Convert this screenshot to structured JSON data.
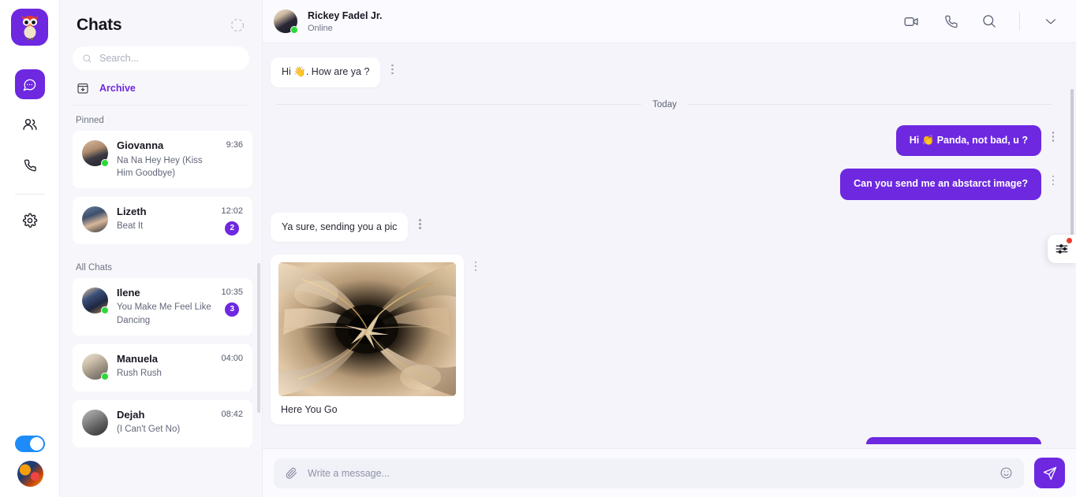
{
  "brand": {
    "accent": "#6d28e0",
    "logo_name": "owl-mascot-logo",
    "online_color": "#2fd73b"
  },
  "rail": {
    "items": [
      {
        "name": "chats",
        "icon": "chat-bubble-icon",
        "active": true
      },
      {
        "name": "contacts",
        "icon": "people-icon",
        "active": false
      },
      {
        "name": "calls",
        "icon": "phone-icon",
        "active": false
      },
      {
        "name": "settings",
        "icon": "gear-icon",
        "active": false
      }
    ],
    "theme_toggle": {
      "icon": "theme-toggle",
      "state": "on"
    },
    "avatar": "user-avatar"
  },
  "sidebar": {
    "title": "Chats",
    "refresh_icon": "refresh-dashed-icon",
    "search": {
      "value": "",
      "placeholder": "Search...",
      "icon": "search-icon"
    },
    "archive": {
      "label": "Archive",
      "icon": "archive-download-icon"
    },
    "groups": [
      {
        "title": "Pinned",
        "chats": [
          {
            "name": "Giovanna",
            "message": "Na Na Hey Hey (Kiss Him Goodbye)",
            "time": "9:36",
            "badge": "",
            "online": true,
            "avatar": "av-giovanna"
          },
          {
            "name": "Lizeth",
            "message": "Beat It",
            "time": "12:02",
            "badge": "2",
            "online": false,
            "avatar": "av-lizeth"
          }
        ]
      },
      {
        "title": "All Chats",
        "chats": [
          {
            "name": "Ilene",
            "message": "You Make Me Feel Like Dancing",
            "time": "10:35",
            "badge": "3",
            "online": true,
            "avatar": "av-ilene"
          },
          {
            "name": "Manuela",
            "message": "Rush Rush",
            "time": "04:00",
            "badge": "",
            "online": true,
            "avatar": "av-manuela"
          },
          {
            "name": "Dejah",
            "message": "(I Can't Get No)",
            "time": "08:42",
            "badge": "",
            "online": false,
            "avatar": "av-dejah"
          }
        ]
      }
    ]
  },
  "conversation": {
    "contact": {
      "name": "Rickey Fadel Jr.",
      "status": "Online",
      "avatar": "av-rickey",
      "online": true
    },
    "header_actions": [
      {
        "name": "video-call",
        "icon": "video-camera-icon"
      },
      {
        "name": "voice-call",
        "icon": "phone-icon"
      },
      {
        "name": "search-in-chat",
        "icon": "search-icon"
      },
      {
        "name": "collapse",
        "icon": "chevron-down-icon"
      }
    ],
    "day_separator": "Today",
    "messages": [
      {
        "id": "m1",
        "direction": "in",
        "type": "text",
        "text": "Hi 👋. How are ya ?"
      },
      {
        "id": "m2",
        "direction": "out",
        "type": "text",
        "text": "Hi 👏 Panda, not bad, u ?"
      },
      {
        "id": "m3",
        "direction": "out",
        "type": "text",
        "text": "Can you send me an abstarct image?"
      },
      {
        "id": "m4",
        "direction": "in",
        "type": "text",
        "text": "Ya sure, sending you a pic"
      },
      {
        "id": "m5",
        "direction": "in",
        "type": "image",
        "text": "Here You Go",
        "image_alt": "abstract-swirl-image"
      }
    ],
    "floating_button": {
      "name": "chat-options",
      "icon": "sliders-icon",
      "has_notification": true
    }
  },
  "composer": {
    "attach_icon": "paperclip-icon",
    "input": {
      "value": "",
      "placeholder": "Write a message..."
    },
    "emoji_icon": "smiley-icon",
    "send": {
      "icon": "send-paper-plane-icon"
    }
  }
}
